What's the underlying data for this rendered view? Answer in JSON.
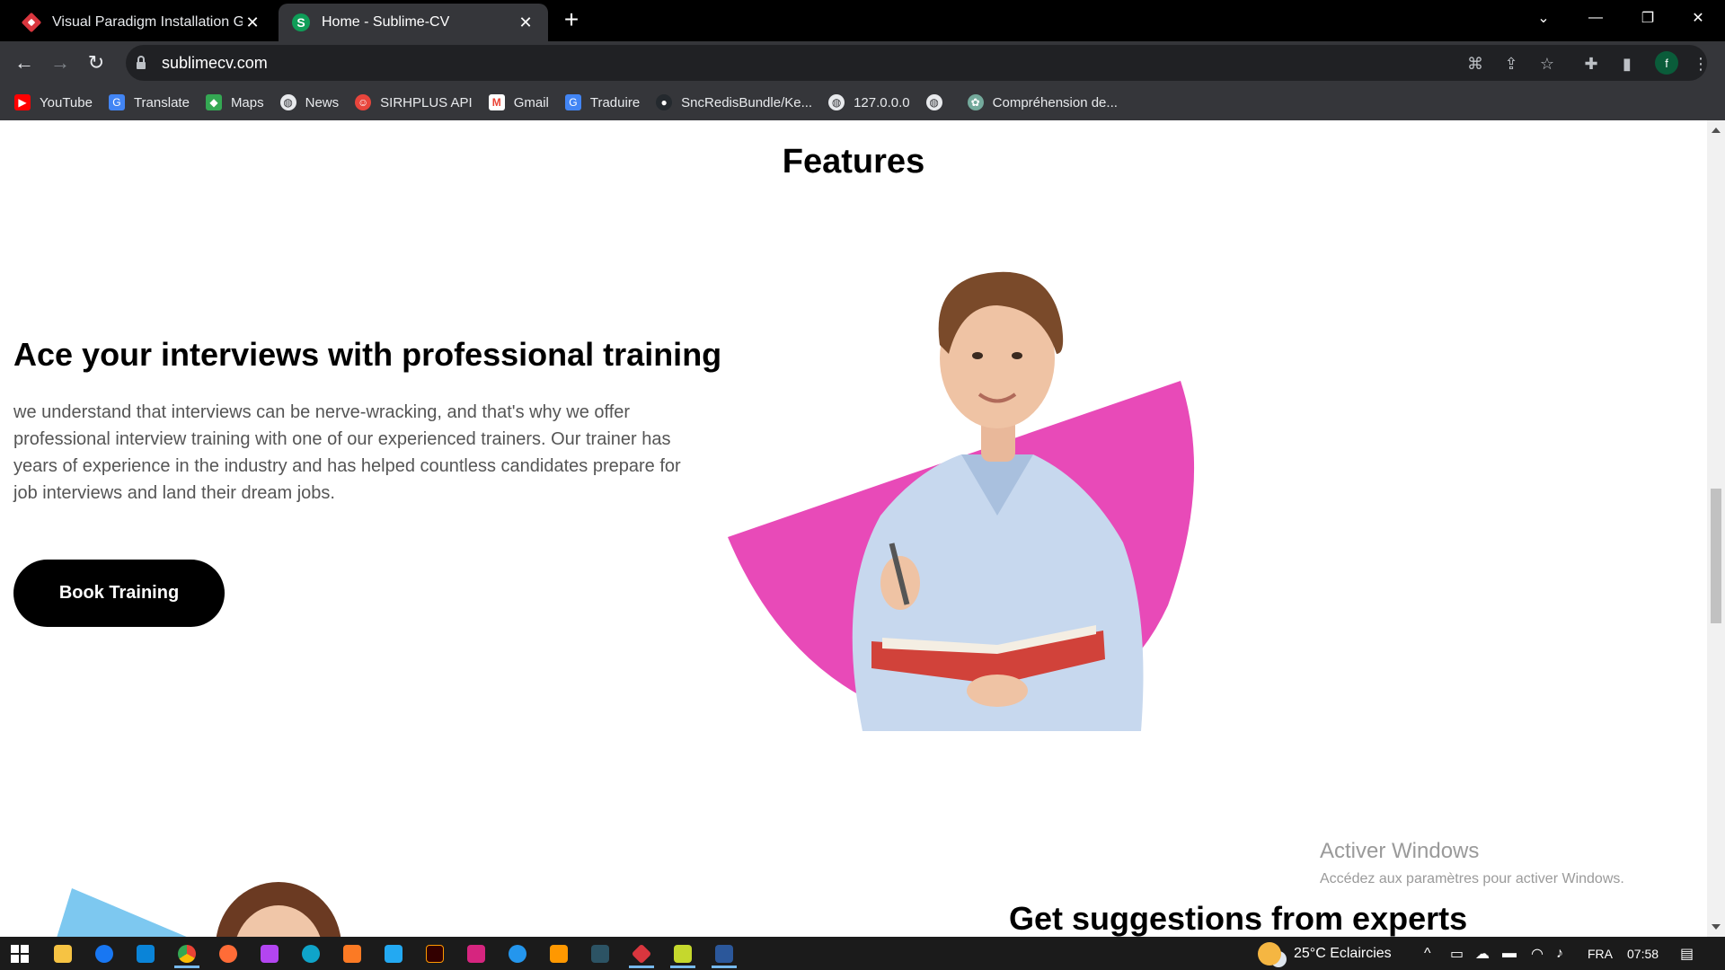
{
  "browser": {
    "tabs": [
      {
        "title": "Visual Paradigm Installation Guid",
        "active": false
      },
      {
        "title": "Home - Sublime-CV",
        "active": true
      }
    ],
    "url": "sublimecv.com",
    "profile_initial": "f",
    "bookmarks": [
      {
        "label": "YouTube",
        "icon": "youtube-icon",
        "color": "#ff0000"
      },
      {
        "label": "Translate",
        "icon": "translate-icon",
        "color": "#4285f4"
      },
      {
        "label": "Maps",
        "icon": "maps-icon",
        "color": "#34a853"
      },
      {
        "label": "News",
        "icon": "globe-icon",
        "color": "#5f6368"
      },
      {
        "label": "SIRHPLUS API",
        "icon": "sirhplus-icon",
        "color": "#e8453c"
      },
      {
        "label": "Gmail",
        "icon": "gmail-icon",
        "color": "#ea4335"
      },
      {
        "label": "Traduire",
        "icon": "translate-icon",
        "color": "#4285f4"
      },
      {
        "label": "SncRedisBundle/Ke...",
        "icon": "github-icon",
        "color": "#24292e"
      },
      {
        "label": "127.0.0.0",
        "icon": "globe-icon",
        "color": "#5f6368"
      },
      {
        "label": "",
        "icon": "globe-icon",
        "color": "#5f6368"
      },
      {
        "label": "Compréhension de...",
        "icon": "chatgpt-icon",
        "color": "#74aa9c"
      }
    ]
  },
  "page": {
    "features_title": "Features",
    "hero": {
      "heading": "Ace your interviews with professional training",
      "text": "we understand that interviews can be nerve-wracking, and that's why we offer professional interview training with one of our experienced trainers. Our trainer has years of experience in the industry and has helped countless candidates prepare for job interviews and land their dream jobs.",
      "button": "Book Training"
    },
    "section2_heading": "Get suggestions from experts",
    "accent_pink": "#e84ab8",
    "accent_blue": "#7dc8f0"
  },
  "os": {
    "activation_title": "Activer Windows",
    "activation_sub": "Accédez aux paramètres pour activer Windows.",
    "weather": "25°C  Eclaircies",
    "language": "FRA",
    "time": "07:58"
  }
}
